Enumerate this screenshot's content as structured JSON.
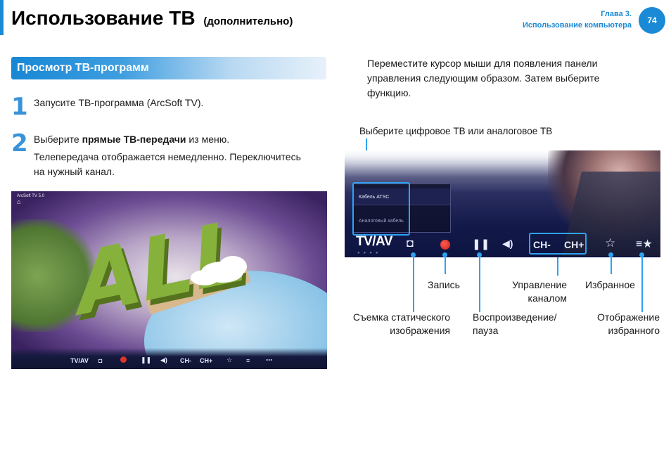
{
  "header": {
    "title": "Использование ТВ",
    "subtitle": "(дополнительно)",
    "chapter_line1": "Глава 3.",
    "chapter_line2": "Использование компьютера",
    "page_number": "74"
  },
  "section": {
    "title": "Просмотр ТВ-программ"
  },
  "steps": [
    {
      "number": "1",
      "text": "Запусите ТВ-программа (ArcSoft TV)."
    },
    {
      "number": "2",
      "text_before": "Выберите ",
      "text_bold": "прямые ТВ-передачи",
      "text_after": " из меню.",
      "note_line1": "Телепередача отображается немедленно. Переключитесь",
      "note_line2": "на нужный канал."
    }
  ],
  "screenshot": {
    "corner_label": "ArcSoft TV 5.0",
    "art_text": "ALL",
    "toolbar": {
      "tvav": "TV/AV",
      "ch_minus": "CH-",
      "ch_plus": "CH+"
    }
  },
  "right": {
    "intro_line1": "Переместите курсор мыши для появления панели",
    "intro_line2": "управления следующим образом. Затем выберите",
    "intro_line3": "функцию.",
    "top_caption": "Выберите цифровое ТВ или аналоговое ТВ"
  },
  "panel": {
    "menu_item_1": "Кабель ATSC",
    "menu_item_2": "Аналоговый кабель",
    "tvav": "TV/AV",
    "ch_minus": "CH-",
    "ch_plus": "CH+",
    "accent_color": "#2ea3f2"
  },
  "callouts": {
    "record": "Запись",
    "channel_line1": "Управление",
    "channel_line2": "каналом",
    "favorites": "Избранное",
    "snapshot_line1": "Съемка статического",
    "snapshot_line2": "изображения",
    "play_line1": "Воспроизведение/",
    "play_line2": "пауза",
    "show_fav_line1": "Отображение",
    "show_fav_line2": "избранного"
  }
}
